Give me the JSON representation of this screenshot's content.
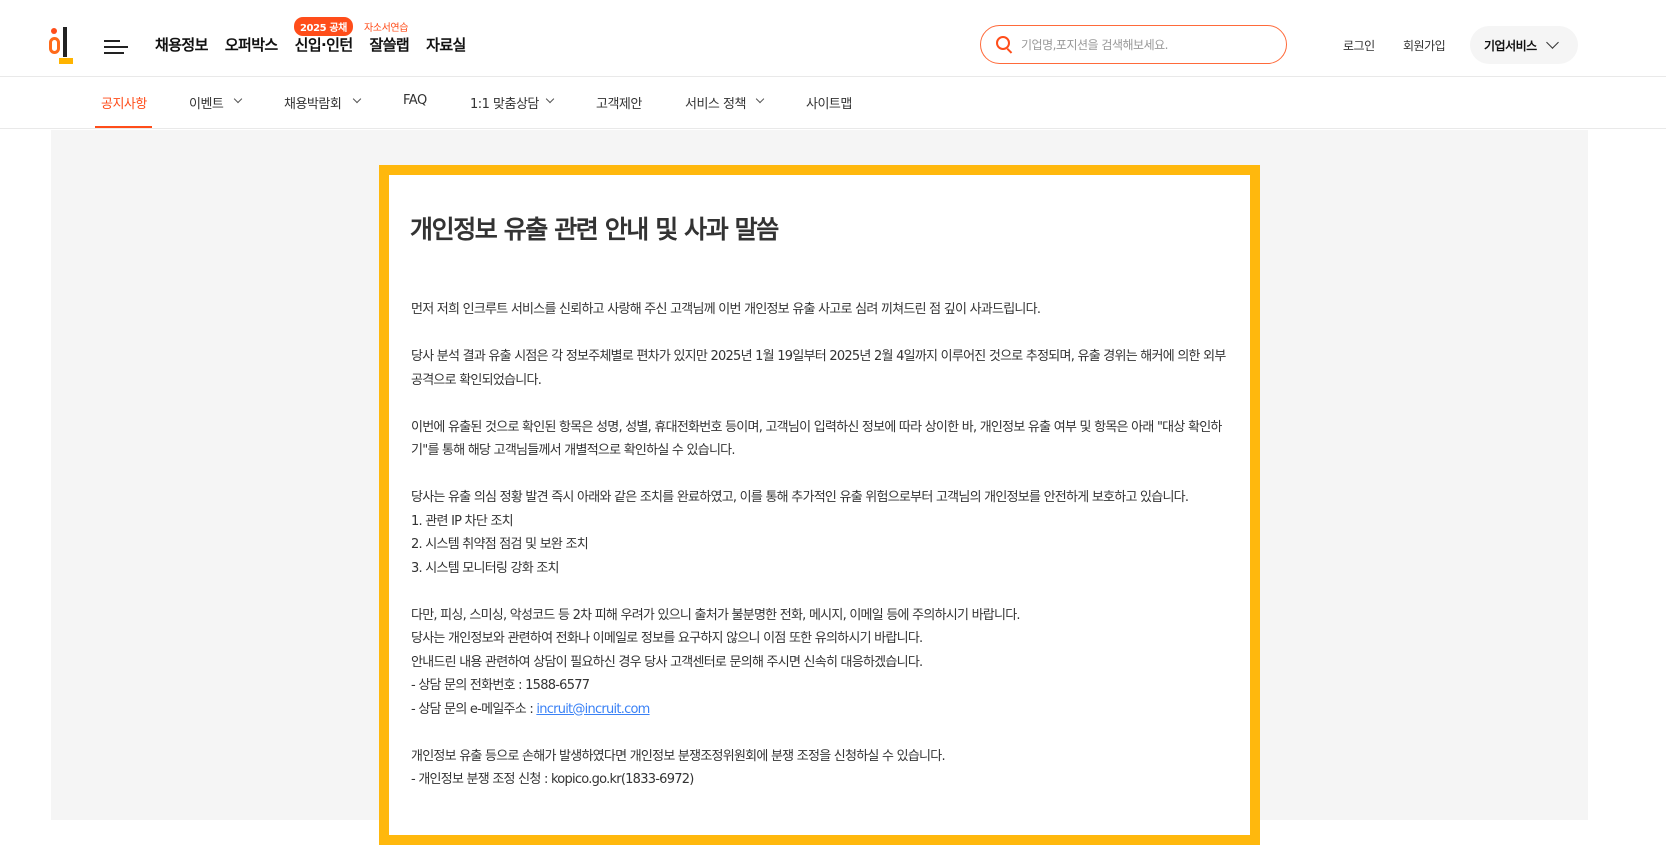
{
  "header": {
    "menu": [
      "채용정보",
      "오퍼박스",
      "신입·인턴",
      "잘쓸랩",
      "자료실"
    ],
    "badge_pill": "2025 공채",
    "badge_text": "자소서연습",
    "search_placeholder": "기업명,포지션을 검색해보세요.",
    "login": "로그인",
    "signup": "회원가입",
    "corp_service": "기업서비스"
  },
  "subnav": {
    "items": [
      "공지사항",
      "이벤트",
      "채용박람회",
      "FAQ",
      "1:1 맞춤상담",
      "고객제안",
      "서비스 정책",
      "사이트맵"
    ],
    "active": "공지사항"
  },
  "notice": {
    "title": "개인정보 유출 관련 안내 및 사과 말씀",
    "p1": "먼저 저희 인크루트 서비스를 신뢰하고 사랑해 주신 고객님께 이번 개인정보 유출 사고로 심려 끼쳐드린 점 깊이 사과드립니다.",
    "p2": "당사 분석 결과 유출 시점은 각 정보주체별로 편차가 있지만 2025년 1월 19일부터 2025년 2월 4일까지 이루어진 것으로 추정되며, 유출 경위는 해커에 의한 외부 공격으로 확인되었습니다.",
    "p3": "이번에 유출된 것으로 확인된 항목은 성명, 성별, 휴대전화번호 등이며, 고객님이 입력하신 정보에 따라 상이한 바, 개인정보 유출 여부 및 항목은 아래 \"대상 확인하기\"를 통해 해당 고객님들께서 개별적으로 확인하실 수 있습니다.",
    "p4": "당사는 유출 의심 정황 발견 즉시 아래와 같은 조치를 완료하였고, 이를 통해 추가적인 유출 위험으로부터 고객님의 개인정보를 안전하게 보호하고 있습니다.",
    "measures": [
      "1. 관련 IP 차단 조치",
      "2. 시스템 취약점 점검 및 보완 조치",
      "3. 시스템 모니터링 강화 조치"
    ],
    "p5": "다만, 피싱, 스미싱, 악성코드 등 2차 피해 우려가 있으니 출처가 불분명한 전화, 메시지, 이메일 등에 주의하시기 바랍니다.",
    "p6": "당사는 개인정보와 관련하여 전화나 이메일로 정보를 요구하지 않으니 이점 또한 유의하시기 바랍니다.",
    "p7": "안내드린 내용 관련하여 상담이 필요하신 경우 당사 고객센터로 문의해 주시면 신속히 대응하겠습니다.",
    "phone_label": "- 상담 문의 전화번호 : 1588-6577",
    "email_label": "- 상담 문의 e-메일주소 : ",
    "email": "incruit@incruit.com",
    "p8": "개인정보 유출 등으로 손해가 발생하였다면 개인정보 분쟁조정위원회에 분쟁 조정을 신청하실 수 있습니다.",
    "p9": "- 개인정보 분쟁 조정 신청 : kopico.go.kr(1833-6972)"
  }
}
